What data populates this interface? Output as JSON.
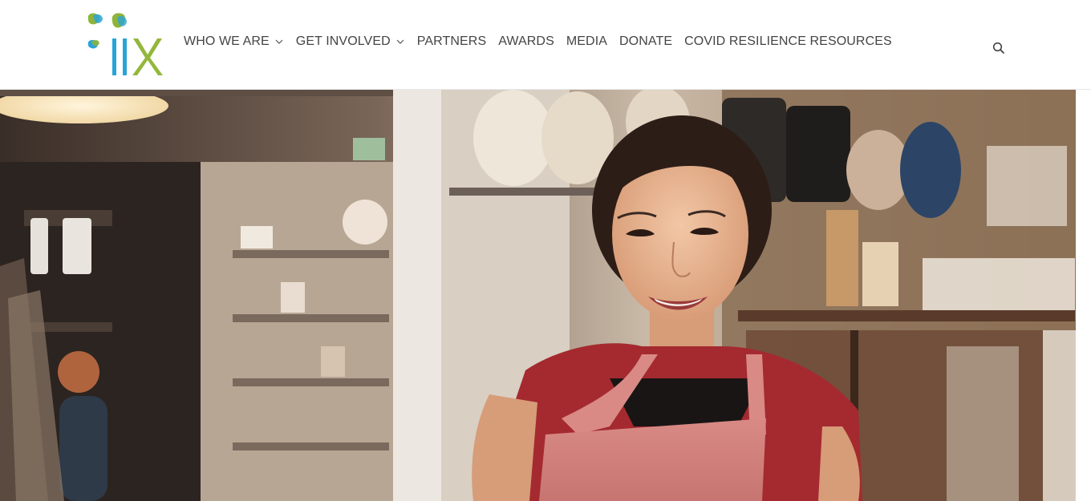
{
  "logo": {
    "text": "IIX",
    "colors": {
      "green": "#8fb43a",
      "blue": "#2ba5d8",
      "text_blue": "#2aa4d6",
      "text_green": "#93b73b"
    }
  },
  "nav": {
    "items": [
      {
        "label": "WHO WE ARE",
        "has_dropdown": true
      },
      {
        "label": "GET INVOLVED",
        "has_dropdown": true
      },
      {
        "label": "PARTNERS",
        "has_dropdown": false
      },
      {
        "label": "AWARDS",
        "has_dropdown": false
      },
      {
        "label": "MEDIA",
        "has_dropdown": false
      },
      {
        "label": "DONATE",
        "has_dropdown": false
      },
      {
        "label": "COVID RESILIENCE RESOURCES",
        "has_dropdown": false
      }
    ]
  },
  "search": {
    "icon": "search-icon"
  },
  "hero": {
    "image": "smiling-shop-owner-in-apron"
  },
  "colors": {
    "nav_text": "#444444",
    "header_bg": "#ffffff"
  }
}
